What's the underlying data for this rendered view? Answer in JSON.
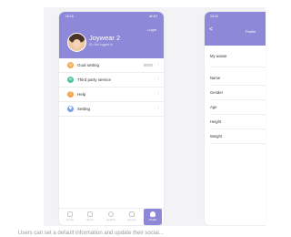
{
  "phone1": {
    "status_time": "16:16",
    "status_icons": "all 4G",
    "user_name": "Joywear 2",
    "user_sub": "ID: Not logged in",
    "login_label": "Login",
    "menu": [
      {
        "label": "Goal setting",
        "value": "8000",
        "icon": "target-icon",
        "color": "#f0a44a"
      },
      {
        "label": "Third party service",
        "value": "",
        "icon": "link-icon",
        "color": "#4fc3a1"
      },
      {
        "label": "Help",
        "value": "",
        "icon": "help-icon",
        "color": "#f2a552"
      },
      {
        "label": "Setting",
        "value": "",
        "icon": "gear-icon",
        "color": "#7a9fe6"
      }
    ],
    "tabs": [
      {
        "label": "Home",
        "icon": "home-icon"
      },
      {
        "label": "Sport",
        "icon": "sport-icon"
      },
      {
        "label": "Healthy",
        "icon": "heart-icon"
      },
      {
        "label": "Device",
        "icon": "watch-icon"
      },
      {
        "label": "Profile",
        "icon": "user-icon",
        "active": true
      }
    ]
  },
  "phone2": {
    "status_time": "16:16",
    "back_label": "<",
    "title": "Profile",
    "rows": [
      "My avatar",
      "Name",
      "Gender",
      "Age",
      "Height",
      "Weight"
    ]
  },
  "caption": "Users can set a default information and update their social..."
}
